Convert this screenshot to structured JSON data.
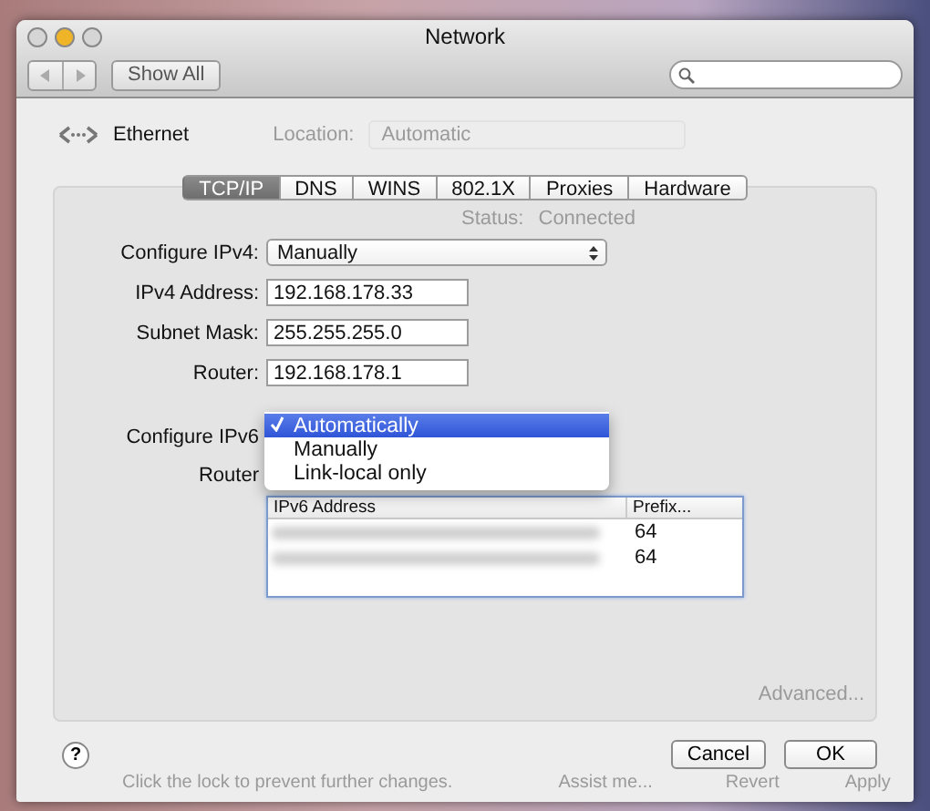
{
  "window": {
    "title": "Network",
    "show_all": "Show All"
  },
  "service": {
    "name": "Ethernet"
  },
  "background": {
    "location_label": "Location:",
    "location_value": "Automatic",
    "status_label": "Status:",
    "status_value": "Connected",
    "advanced": "Advanced...",
    "lock_note": "Click the lock to prevent further changes.",
    "assist": "Assist me...",
    "revert": "Revert",
    "apply": "Apply"
  },
  "tabs": [
    {
      "label": "TCP/IP",
      "selected": true
    },
    {
      "label": "DNS",
      "selected": false
    },
    {
      "label": "WINS",
      "selected": false
    },
    {
      "label": "802.1X",
      "selected": false
    },
    {
      "label": "Proxies",
      "selected": false
    },
    {
      "label": "Hardware",
      "selected": false
    }
  ],
  "ipv4": {
    "label": "Configure IPv4:",
    "value": "Manually",
    "fields": [
      {
        "label": "IPv4 Address:",
        "value": "192.168.178.33"
      },
      {
        "label": "Subnet Mask:",
        "value": "255.255.255.0"
      },
      {
        "label": "Router:",
        "value": "192.168.178.1"
      }
    ]
  },
  "ipv6": {
    "label": "Configure IPv6",
    "router_label": "Router",
    "menu": [
      {
        "label": "Automatically",
        "selected": true
      },
      {
        "label": "Manually",
        "selected": false
      },
      {
        "label": "Link-local only",
        "selected": false
      }
    ],
    "table": {
      "columns": [
        "IPv6 Address",
        "Prefix..."
      ],
      "rows": [
        {
          "address_blurred": true,
          "prefix": "64"
        },
        {
          "address_blurred": true,
          "prefix": "64"
        }
      ]
    }
  },
  "help": "?",
  "buttons": [
    {
      "label": "Cancel",
      "default": false
    },
    {
      "label": "OK",
      "default": false
    }
  ]
}
